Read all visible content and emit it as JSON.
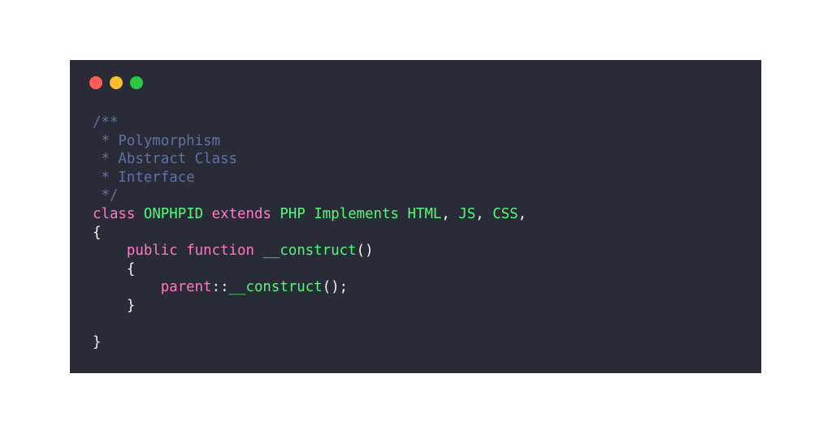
{
  "window": {
    "buttons": [
      {
        "name": "close",
        "color": "#ff5f56"
      },
      {
        "name": "minimize",
        "color": "#ffbd2e"
      },
      {
        "name": "maximize",
        "color": "#27c93f"
      }
    ]
  },
  "theme": {
    "background": "#292b37",
    "comment": "#6272a4",
    "keyword": "#ff79c6",
    "name": "#50fa7b",
    "text": "#f8f8f2"
  },
  "code": {
    "lines": [
      [
        {
          "t": "comment",
          "v": "/**"
        }
      ],
      [
        {
          "t": "comment",
          "v": " * Polymorphism"
        }
      ],
      [
        {
          "t": "comment",
          "v": " * Abstract Class"
        }
      ],
      [
        {
          "t": "comment",
          "v": " * Interface"
        }
      ],
      [
        {
          "t": "comment",
          "v": " */"
        }
      ],
      [
        {
          "t": "keyword",
          "v": "class"
        },
        {
          "t": "plain",
          "v": " "
        },
        {
          "t": "name",
          "v": "ONPHPID"
        },
        {
          "t": "plain",
          "v": " "
        },
        {
          "t": "keyword",
          "v": "extends"
        },
        {
          "t": "plain",
          "v": " "
        },
        {
          "t": "name",
          "v": "PHP"
        },
        {
          "t": "plain",
          "v": " "
        },
        {
          "t": "name",
          "v": "Implements"
        },
        {
          "t": "plain",
          "v": " "
        },
        {
          "t": "name",
          "v": "HTML"
        },
        {
          "t": "punct",
          "v": ", "
        },
        {
          "t": "name",
          "v": "JS"
        },
        {
          "t": "punct",
          "v": ", "
        },
        {
          "t": "name",
          "v": "CSS"
        },
        {
          "t": "punct",
          "v": ","
        }
      ],
      [
        {
          "t": "punct",
          "v": "{"
        }
      ],
      [
        {
          "t": "plain",
          "v": "    "
        },
        {
          "t": "keyword",
          "v": "public"
        },
        {
          "t": "plain",
          "v": " "
        },
        {
          "t": "keyword",
          "v": "function"
        },
        {
          "t": "plain",
          "v": " "
        },
        {
          "t": "name",
          "v": "__construct"
        },
        {
          "t": "punct",
          "v": "()"
        }
      ],
      [
        {
          "t": "plain",
          "v": "    "
        },
        {
          "t": "punct",
          "v": "{"
        }
      ],
      [
        {
          "t": "plain",
          "v": "        "
        },
        {
          "t": "keyword",
          "v": "parent"
        },
        {
          "t": "punct",
          "v": "::"
        },
        {
          "t": "name",
          "v": "__construct"
        },
        {
          "t": "punct",
          "v": "();"
        }
      ],
      [
        {
          "t": "plain",
          "v": "    "
        },
        {
          "t": "punct",
          "v": "}"
        }
      ],
      [
        {
          "t": "plain",
          "v": ""
        }
      ],
      [
        {
          "t": "punct",
          "v": "}"
        }
      ]
    ]
  }
}
